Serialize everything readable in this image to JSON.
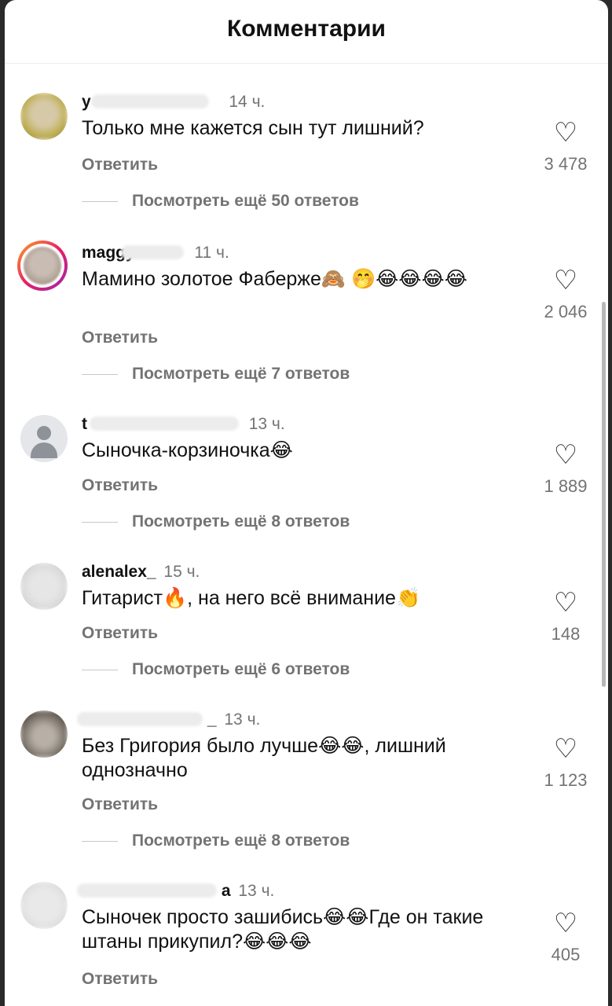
{
  "header": {
    "title": "Комментарии"
  },
  "comments": [
    {
      "username": "y",
      "time": "14 ч.",
      "text": "Только мне кажется сын тут лишний?",
      "reply_label": "Ответить",
      "likes": "3 478",
      "view_more": "Посмотреть ещё 50 ответов"
    },
    {
      "username": "maggy",
      "time": "11 ч.",
      "text": "Мамино золотое Фаберже🙈 🤭😂😂😂😂",
      "reply_label": "Ответить",
      "likes": "2 046",
      "view_more": "Посмотреть ещё 7 ответов"
    },
    {
      "username": "t",
      "time": "13 ч.",
      "text": "Сыночка-корзиночка😂",
      "reply_label": "Ответить",
      "likes": "1 889",
      "view_more": "Посмотреть ещё 8 ответов"
    },
    {
      "username": "alenalex_",
      "time": "15 ч.",
      "text": "Гитарист🔥, на него всё внимание👏",
      "reply_label": "Ответить",
      "likes": "148",
      "view_more": "Посмотреть ещё 6 ответов"
    },
    {
      "username": "_",
      "time": "13 ч.",
      "text": "Без Григория было лучше😂😂, лишний однозначно",
      "reply_label": "Ответить",
      "likes": "1 123",
      "view_more": "Посмотреть ещё 8 ответов"
    },
    {
      "username": "a",
      "time": "13 ч.",
      "text": "Сыночек просто зашибись😂😂Где он такие штаны прикупил?😂😂😂",
      "reply_label": "Ответить",
      "likes": "405"
    }
  ],
  "icons": {
    "like": "heart-outline-icon"
  }
}
